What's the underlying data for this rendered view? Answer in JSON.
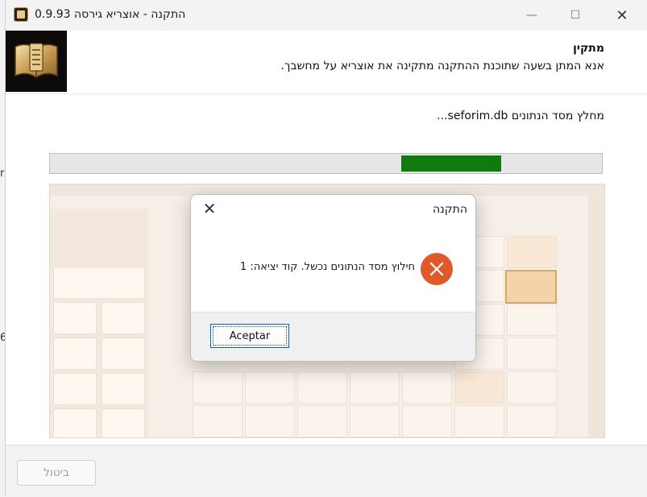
{
  "window": {
    "title": "התקנה - אוצריא גירסה 0.9.93",
    "minimize_glyph": "—",
    "maximize_glyph": "☐",
    "close_glyph": "✕"
  },
  "header": {
    "title": "מתקין",
    "subtitle": "אנא המתן בשעה שתוכנת ההתקנה מתקינה את אוצריא על מחשבך."
  },
  "status": {
    "text": "מחלץ מסד הנתונים seforim.db..."
  },
  "progress": {
    "fill_start": 0.637,
    "fill_end": 0.818,
    "color": "#0f7b0f"
  },
  "footer": {
    "cancel_label": "ביטול"
  },
  "dialog": {
    "title": "התקנה",
    "close_glyph": "✕",
    "message": "חילוץ מסד הנתונים נכשל. קוד יציאה: 1",
    "error_icon": "error-x-icon",
    "accept_label": "Aceptar",
    "error_color": "#e05a29"
  },
  "background_fragments": {
    "top": "r",
    "bottom": "6"
  }
}
